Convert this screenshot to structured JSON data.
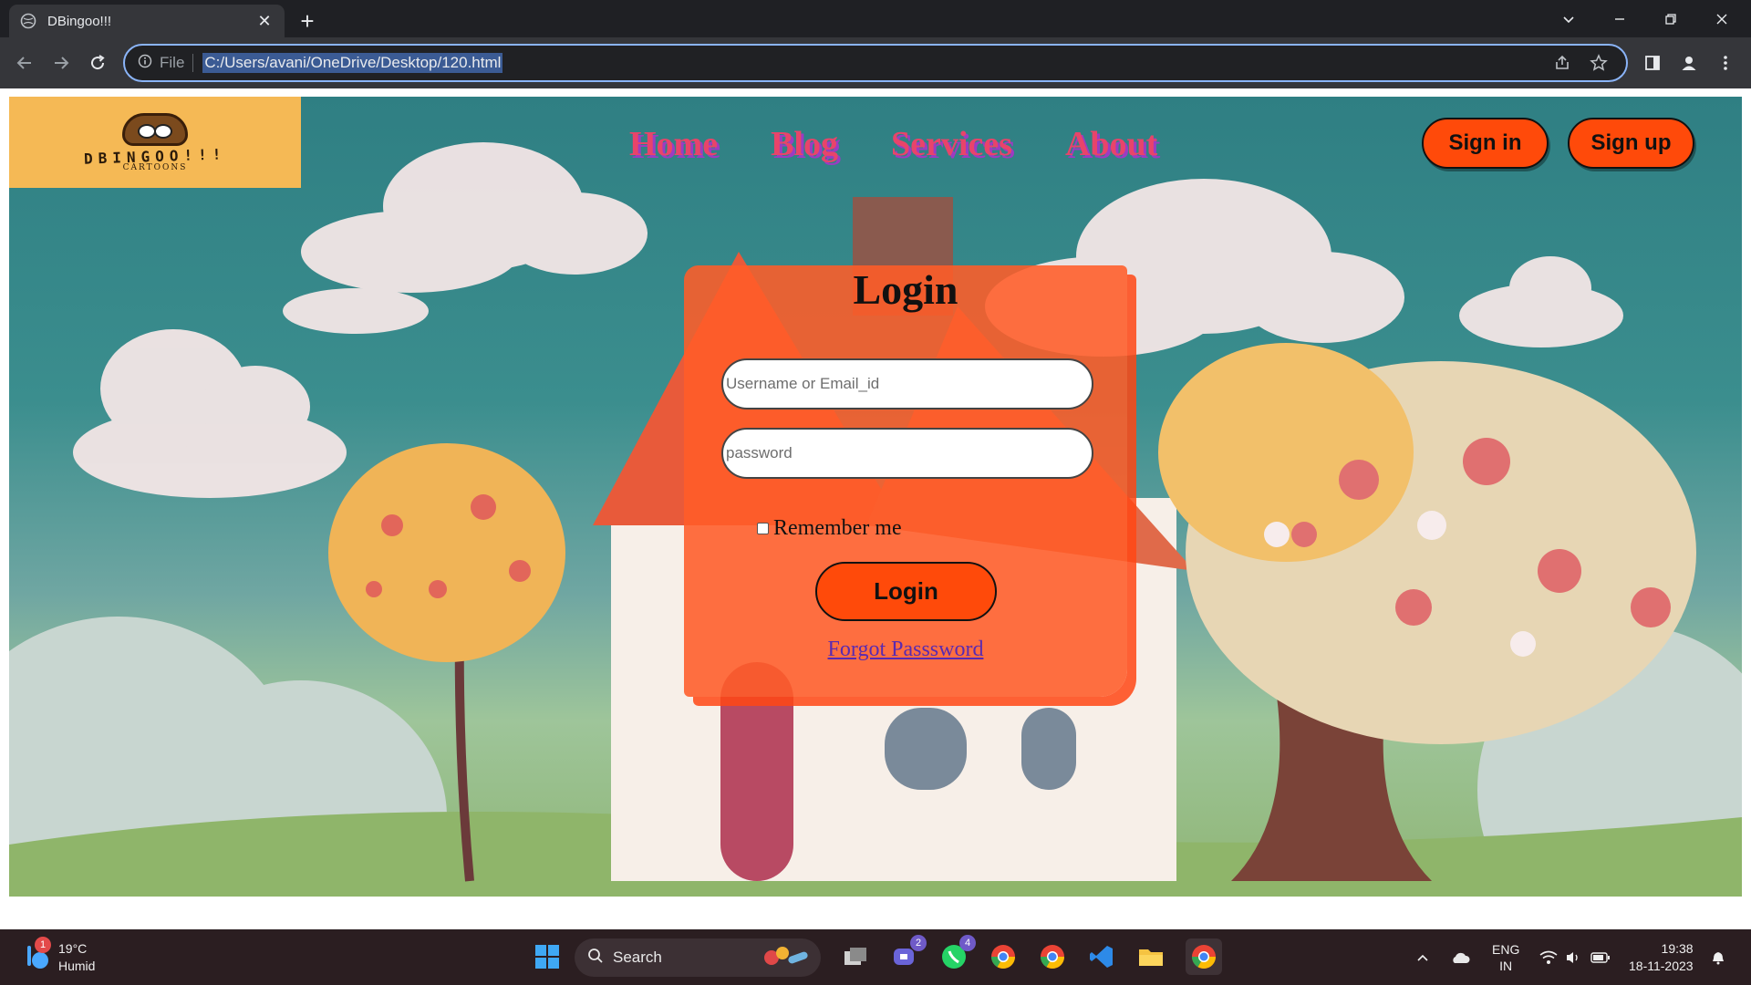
{
  "browser": {
    "tab_title": "DBingoo!!!",
    "omnibox_scheme_label": "File",
    "url": "C:/Users/avani/OneDrive/Desktop/120.html"
  },
  "site": {
    "logo_text": "DBINGOO!!!",
    "logo_subtext": "CARTOONS",
    "nav": [
      "Home",
      "Blog",
      "Services",
      "About"
    ],
    "signin_label": "Sign in",
    "signup_label": "Sign up"
  },
  "login": {
    "title": "Login",
    "username_placeholder": "Username or Email_id",
    "password_placeholder": "password",
    "remember_label": "Remember me",
    "remember_checked": false,
    "submit_label": "Login",
    "forgot_label": "Forgot Passsword"
  },
  "taskbar": {
    "weather_temp": "19°C",
    "weather_desc": "Humid",
    "weather_badge": "1",
    "search_label": "Search",
    "teams_badge": "2",
    "whatsapp_badge": "4",
    "lang_top": "ENG",
    "lang_bottom": "IN",
    "time": "19:38",
    "date": "18-11-2023"
  },
  "colors": {
    "accent_orange": "#ff4a0a",
    "nav_pink": "#e8446a",
    "nav_shadow": "#9b3cc2"
  }
}
